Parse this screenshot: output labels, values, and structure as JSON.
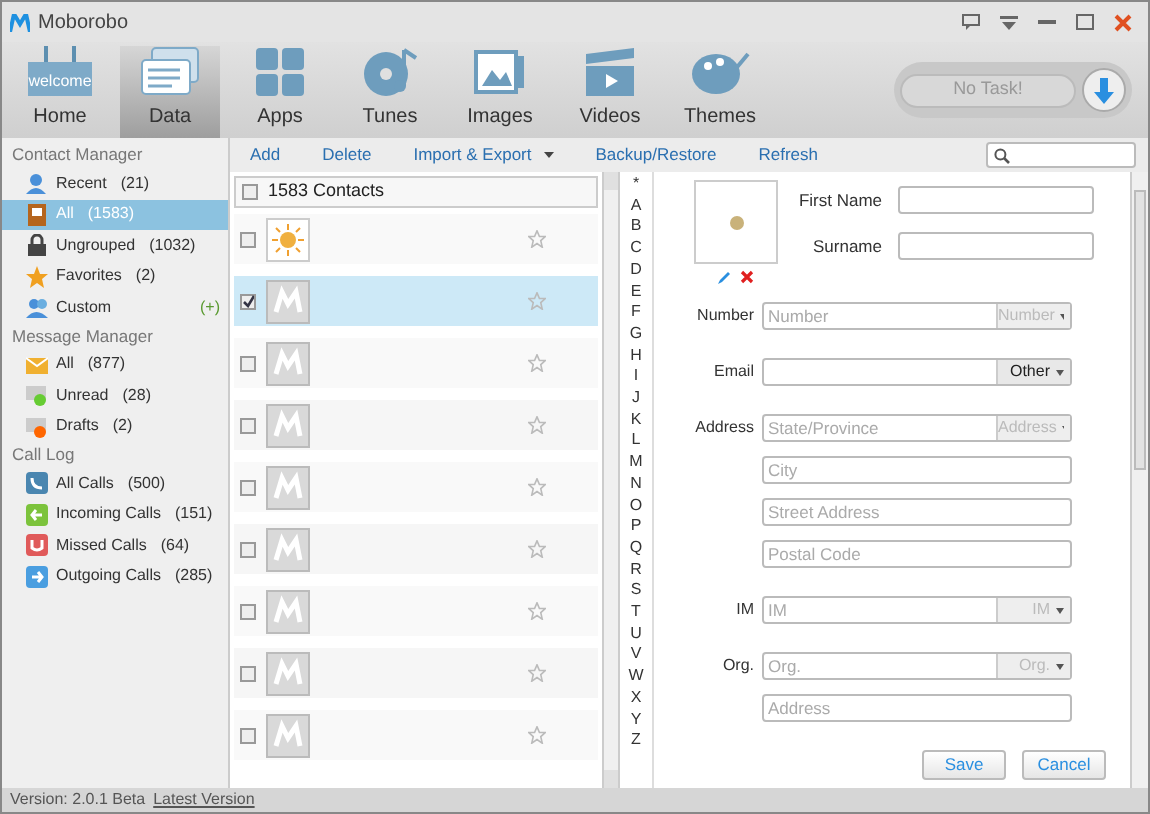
{
  "window": {
    "title": "Moborobo"
  },
  "nav_tabs": [
    {
      "label": "Home",
      "icon_text": "welcome",
      "selected": false
    },
    {
      "label": "Data",
      "selected": true
    },
    {
      "label": "Apps",
      "selected": false
    },
    {
      "label": "Tunes",
      "selected": false
    },
    {
      "label": "Images",
      "selected": false
    },
    {
      "label": "Videos",
      "selected": false
    },
    {
      "label": "Themes",
      "selected": false
    }
  ],
  "task_status": "No Task!",
  "sidebar": {
    "sections": [
      {
        "title": "Contact Manager",
        "items": [
          {
            "label": "Recent",
            "count": "(21)",
            "selected": false
          },
          {
            "label": "All",
            "count": "(1583)",
            "selected": true
          },
          {
            "label": "Ungrouped",
            "count": "(1032)",
            "selected": false
          },
          {
            "label": "Favorites",
            "count": "(2)",
            "selected": false
          },
          {
            "label": "Custom",
            "count": "(+)",
            "selected": false
          }
        ]
      },
      {
        "title": "Message Manager",
        "items": [
          {
            "label": "All",
            "count": "(877)",
            "selected": false
          },
          {
            "label": "Unread",
            "count": "(28)",
            "selected": false
          },
          {
            "label": "Drafts",
            "count": "(2)",
            "selected": false
          }
        ]
      },
      {
        "title": "Call Log",
        "items": [
          {
            "label": "All Calls",
            "count": "(500)",
            "selected": false
          },
          {
            "label": "Incoming Calls",
            "count": "(151)",
            "selected": false
          },
          {
            "label": "Missed Calls",
            "count": "(64)",
            "selected": false
          },
          {
            "label": "Outgoing Calls",
            "count": "(285)",
            "selected": false
          }
        ]
      }
    ]
  },
  "actions": [
    {
      "label": "Add"
    },
    {
      "label": "Delete"
    },
    {
      "label": "Import & Export",
      "dropdown": true
    },
    {
      "label": "Backup/Restore"
    },
    {
      "label": "Refresh"
    }
  ],
  "contacts": {
    "header": "1583 Contacts",
    "header_checked": false,
    "rows": [
      {
        "kind": "sun",
        "checked": false,
        "selected": false
      },
      {
        "kind": "blank",
        "checked": true,
        "selected": true
      },
      {
        "kind": "blank",
        "checked": false,
        "selected": false
      },
      {
        "kind": "blank",
        "checked": false,
        "selected": false
      },
      {
        "kind": "blank",
        "checked": false,
        "selected": false
      },
      {
        "kind": "blank",
        "checked": false,
        "selected": false
      },
      {
        "kind": "blank",
        "checked": false,
        "selected": false
      },
      {
        "kind": "blank",
        "checked": false,
        "selected": false
      },
      {
        "kind": "blank",
        "checked": false,
        "selected": false
      }
    ]
  },
  "alphabet": [
    "*",
    "A",
    "B",
    "C",
    "D",
    "E",
    "F",
    "G",
    "H",
    "I",
    "J",
    "K",
    "L",
    "M",
    "N",
    "O",
    "P",
    "Q",
    "R",
    "S",
    "T",
    "U",
    "V",
    "W",
    "X",
    "Y",
    "Z"
  ],
  "form": {
    "first_name_label": "First Name",
    "surname_label": "Surname",
    "rows": [
      {
        "label": "Number",
        "placeholder": "Number",
        "select": "Number",
        "select_disabled": true
      },
      {
        "label": "Email",
        "select": "Other",
        "select_disabled": false
      },
      {
        "label": "Address",
        "placeholder": "State/Province",
        "select": "Address",
        "select_disabled": true
      },
      {
        "placeholder": "City"
      },
      {
        "placeholder": "Street Address"
      },
      {
        "placeholder": "Postal Code"
      },
      {
        "label": "IM",
        "placeholder": "IM",
        "select": "IM",
        "select_disabled": true
      },
      {
        "label": "Org.",
        "placeholder": "Org.",
        "select": "Org.",
        "select_disabled": true
      },
      {
        "placeholder": "Address"
      }
    ],
    "buttons": [
      "Save",
      "Cancel"
    ]
  },
  "status_bar": {
    "version": "Version: 2.0.1 Beta",
    "link": "Latest Version"
  }
}
